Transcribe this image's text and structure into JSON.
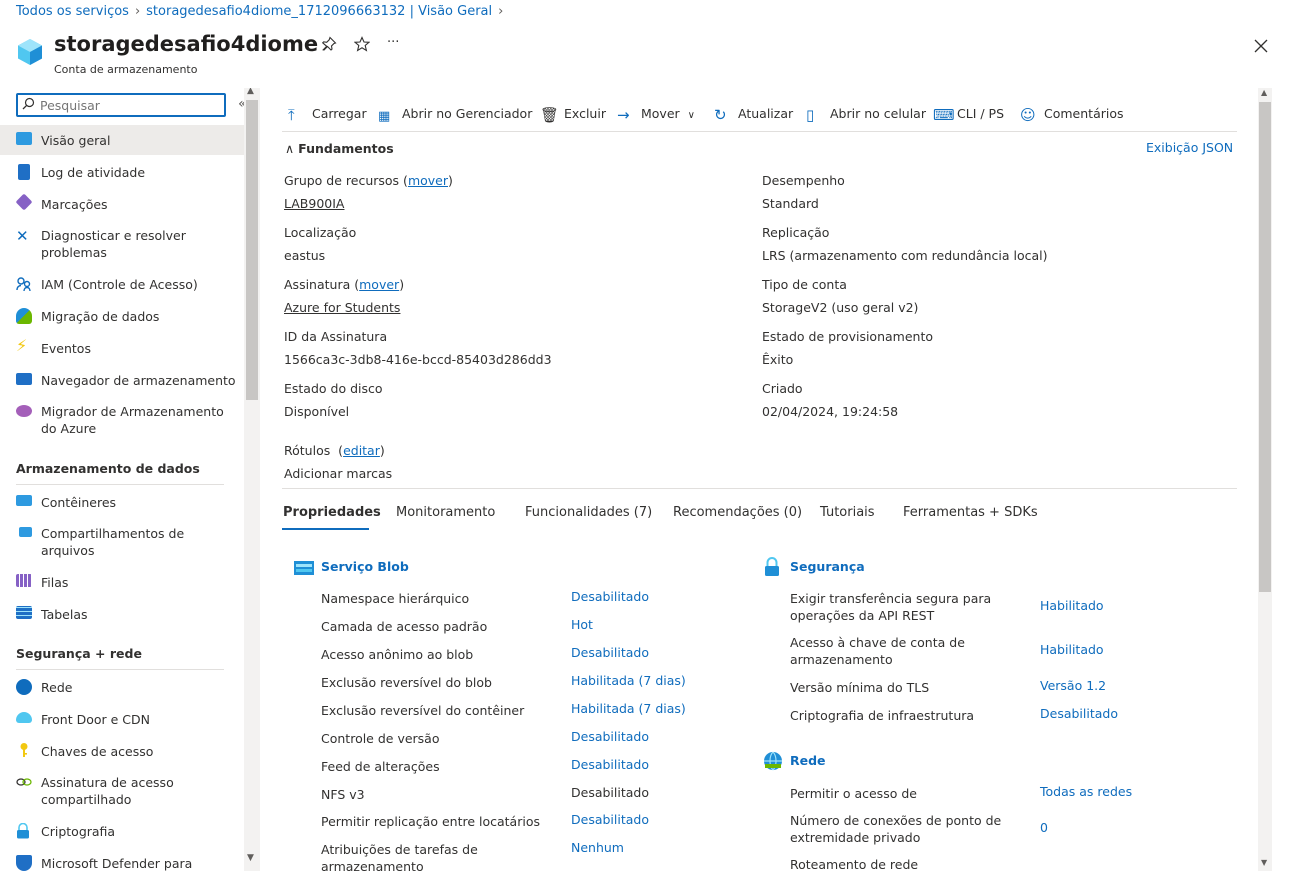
{
  "breadcrumb": [
    "Todos os serviços",
    "storagedesafio4diome_1712096663132 | Visão Geral"
  ],
  "header": {
    "title": "storagedesafio4diome",
    "subtitle": "Conta de armazenamento",
    "pin_icon": "pin-icon",
    "star_icon": "star-icon",
    "more_label": "···",
    "close_label": "✕"
  },
  "sidebar": {
    "search_placeholder": "Pesquisar",
    "collapse_label": "«",
    "items": [
      {
        "label": "Visão geral",
        "icon": "overview-icon"
      },
      {
        "label": "Log de atividade",
        "icon": "activity-log-icon"
      },
      {
        "label": "Marcações",
        "icon": "tag-icon"
      },
      {
        "label": "Diagnosticar e resolver problemas",
        "icon": "wrench-icon"
      },
      {
        "label": "IAM (Controle de Acesso)",
        "icon": "people-icon"
      },
      {
        "label": "Migração de dados",
        "icon": "migration-icon"
      },
      {
        "label": "Eventos",
        "icon": "lightning-icon"
      },
      {
        "label": "Navegador de armazenamento",
        "icon": "storage-browser-icon"
      },
      {
        "label": "Migrador de Armazenamento do Azure",
        "icon": "cloud-migrate-icon"
      }
    ],
    "section_data": "Armazenamento de dados",
    "data_items": [
      {
        "label": "Contêineres",
        "icon": "containers-icon"
      },
      {
        "label": "Compartilhamentos de arquivos",
        "icon": "file-share-icon"
      },
      {
        "label": "Filas",
        "icon": "queue-icon"
      },
      {
        "label": "Tabelas",
        "icon": "table-icon"
      }
    ],
    "section_security": "Segurança + rede",
    "security_items": [
      {
        "label": "Rede",
        "icon": "network-icon"
      },
      {
        "label": "Front Door e CDN",
        "icon": "cdn-icon"
      },
      {
        "label": "Chaves de acesso",
        "icon": "key-icon"
      },
      {
        "label": "Assinatura de acesso compartilhado",
        "icon": "link-icon"
      },
      {
        "label": "Criptografia",
        "icon": "lock-icon"
      },
      {
        "label": "Microsoft Defender para",
        "icon": "shield-icon"
      }
    ]
  },
  "toolbar": {
    "upload": "Carregar",
    "open_explorer": "Abrir no Gerenciador",
    "delete": "Excluir",
    "move": "Mover",
    "refresh": "Atualizar",
    "mobile": "Abrir no celular",
    "cli": "CLI / PS",
    "feedback": "Comentários"
  },
  "essentials": {
    "heading": "Fundamentos",
    "json_view": "Exibição JSON",
    "left": [
      {
        "label": "Grupo de recursos",
        "extra": "mover",
        "value": "LAB900IA",
        "value_link": true
      },
      {
        "label": "Localização",
        "value": "eastus"
      },
      {
        "label": "Assinatura",
        "extra": "mover",
        "value": "Azure for Students",
        "value_link": true
      },
      {
        "label": "ID da Assinatura",
        "value": "1566ca3c-3db8-416e-bccd-85403d286dd3"
      },
      {
        "label": "Estado do disco",
        "value": "Disponível"
      }
    ],
    "right": [
      {
        "label": "Desempenho",
        "value": "Standard"
      },
      {
        "label": "Replicação",
        "value": "LRS (armazenamento com redundância local)"
      },
      {
        "label": "Tipo de conta",
        "value": "StorageV2 (uso geral v2)"
      },
      {
        "label": "Estado de provisionamento",
        "value": "Êxito"
      },
      {
        "label": "Criado",
        "value": "02/04/2024, 19:24:58"
      }
    ],
    "tags_label": "Rótulos",
    "tags_edit": "editar",
    "add_tags": "Adicionar marcas"
  },
  "tabs": [
    "Propriedades",
    "Monitoramento",
    "Funcionalidades (7)",
    "Recomendações (0)",
    "Tutoriais",
    "Ferramentas + SDKs"
  ],
  "blob": {
    "heading": "Serviço Blob",
    "rows": [
      {
        "label": "Namespace hierárquico",
        "value": "Desabilitado",
        "link": true
      },
      {
        "label": "Camada de acesso padrão",
        "value": "Hot",
        "link": true
      },
      {
        "label": "Acesso anônimo ao blob",
        "value": "Desabilitado",
        "link": true
      },
      {
        "label": "Exclusão reversível do blob",
        "value": "Habilitada (7 dias)",
        "link": true
      },
      {
        "label": "Exclusão reversível do contêiner",
        "value": "Habilitada (7 dias)",
        "link": true
      },
      {
        "label": "Controle de versão",
        "value": "Desabilitado",
        "link": true
      },
      {
        "label": "Feed de alterações",
        "value": "Desabilitado",
        "link": true
      },
      {
        "label": "NFS v3",
        "value": "Desabilitado",
        "link": false
      },
      {
        "label": "Permitir replicação entre locatários",
        "value": "Desabilitado",
        "link": true
      },
      {
        "label": "Atribuições de tarefas de armazenamento",
        "value": "Nenhum",
        "link": true
      }
    ]
  },
  "security": {
    "heading": "Segurança",
    "rows": [
      {
        "label": "Exigir transferência segura para operações da API REST",
        "value": "Habilitado"
      },
      {
        "label": "Acesso à chave de conta de armazenamento",
        "value": "Habilitado"
      },
      {
        "label": "Versão mínima do TLS",
        "value": "Versão 1.2"
      },
      {
        "label": "Criptografia de infraestrutura",
        "value": "Desabilitado"
      }
    ]
  },
  "network": {
    "heading": "Rede",
    "rows": [
      {
        "label": "Permitir o acesso de",
        "value": "Todas as redes"
      },
      {
        "label": "Número de conexões de ponto de extremidade privado",
        "value": "0"
      },
      {
        "label": "Roteamento de rede",
        "value": ""
      }
    ]
  },
  "colors": {
    "accent": "#0f6cbd",
    "selected_bg": "#edebe9"
  }
}
